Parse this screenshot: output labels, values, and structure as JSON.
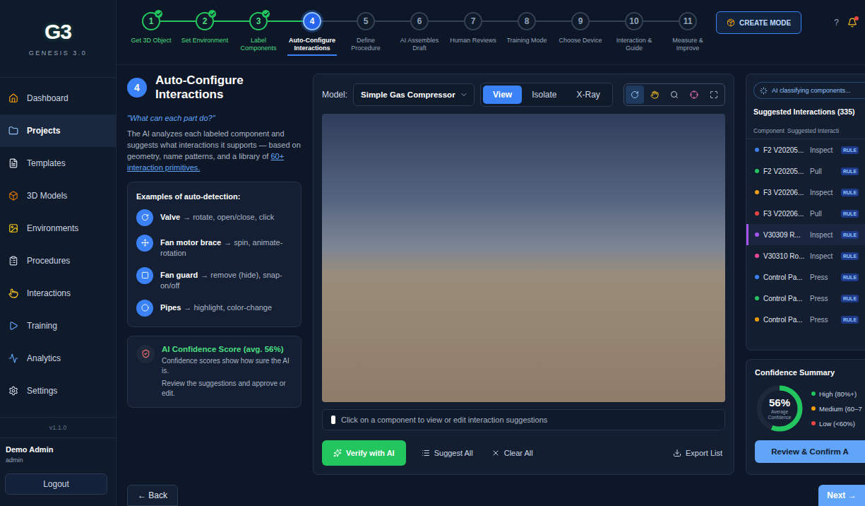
{
  "app": {
    "logo": "G3",
    "subtitle": "GENESIS 3.0",
    "version": "v1.1.0"
  },
  "sidebar": {
    "items": [
      {
        "label": "Dashboard",
        "selected": false
      },
      {
        "label": "Projects",
        "selected": true
      },
      {
        "label": "Templates",
        "selected": false
      },
      {
        "label": "3D Models",
        "selected": false
      },
      {
        "label": "Environments",
        "selected": false
      },
      {
        "label": "Procedures",
        "selected": false
      },
      {
        "label": "Interactions",
        "selected": false
      },
      {
        "label": "Training",
        "selected": false
      },
      {
        "label": "Analytics",
        "selected": false
      },
      {
        "label": "Settings",
        "selected": false
      }
    ]
  },
  "user": {
    "name": "Demo Admin",
    "role": "admin",
    "logout": "Logout"
  },
  "stepper": {
    "steps": [
      {
        "number": "1",
        "label": "Get 3D Object",
        "state": "done"
      },
      {
        "number": "2",
        "label": "Set Environment",
        "state": "done"
      },
      {
        "number": "3",
        "label": "Label Components",
        "state": "done"
      },
      {
        "number": "4",
        "label": "Auto-Configure Interactions",
        "state": "active"
      },
      {
        "number": "5",
        "label": "Define Procedure",
        "state": "pending"
      },
      {
        "number": "6",
        "label": "AI Assembles Draft",
        "state": "pending"
      },
      {
        "number": "7",
        "label": "Human Reviews",
        "state": "pending"
      },
      {
        "number": "8",
        "label": "Training Mode",
        "state": "pending"
      },
      {
        "number": "9",
        "label": "Choose Device",
        "state": "pending"
      },
      {
        "number": "10",
        "label": "Interaction & Guide",
        "state": "pending"
      },
      {
        "number": "11",
        "label": "Measure & Improve",
        "state": "pending"
      }
    ]
  },
  "header": {
    "create_mode": "CREATE MODE",
    "help": "?"
  },
  "intro": {
    "step": "4",
    "title": "Auto-Configure Interactions",
    "quote": "\"What can each part do?\"",
    "text": "The AI analyzes each labeled component and suggests what interactions it supports — based on geometry, name patterns, and a library of",
    "link": "60+ interaction primitives."
  },
  "examples": {
    "title": "Examples of auto-detection:",
    "items": [
      {
        "name": "Valve",
        "text": "→ rotate, open/close, click"
      },
      {
        "name": "Fan motor brace",
        "text": "→ spin, animate-rotation"
      },
      {
        "name": "Fan guard",
        "text": "→ remove (hide), snap-on/off"
      },
      {
        "name": "Pipes",
        "text": "→ highlight, color-change"
      }
    ]
  },
  "confidence_note": {
    "title": "AI Confidence Score (avg. 56%)",
    "lines": [
      "Confidence scores show how sure the AI is.",
      "Review the suggestions and approve or edit."
    ]
  },
  "viewer": {
    "model_label": "Model:",
    "model": "Simple Gas Compressor",
    "modes": [
      {
        "label": "View",
        "selected": true
      },
      {
        "label": "Isolate",
        "selected": false
      },
      {
        "label": "X-Ray",
        "selected": false
      }
    ],
    "tools": [
      {
        "selected": true
      },
      {
        "selected": false
      },
      {
        "selected": false
      },
      {
        "selected": false
      },
      {
        "selected": false
      }
    ],
    "hint": "Click on a component to view or edit interaction suggestions",
    "actions": [
      {
        "label": "Verify with AI",
        "kind": "primary"
      },
      {
        "label": "Suggest All",
        "kind": "ghost"
      },
      {
        "label": "Clear All",
        "kind": "ghost"
      },
      {
        "label": "Export List",
        "kind": "export"
      }
    ]
  },
  "suggestions": {
    "status": "AI classifying components...",
    "title": "Suggested Interactions (335)",
    "columns": [
      "Component",
      "Suggested Interacti"
    ],
    "rows": [
      {
        "component": "F2 V20205...",
        "interaction": "Inspect",
        "tag": "RULE",
        "color": "#3b82f6",
        "selected": false
      },
      {
        "component": "F2 V20205...",
        "interaction": "Pull",
        "tag": "RULE",
        "color": "#22c55e",
        "selected": false
      },
      {
        "component": "F3 V20206...",
        "interaction": "Inspect",
        "tag": "RULE",
        "color": "#f59e0b",
        "selected": false
      },
      {
        "component": "F3 V20206...",
        "interaction": "Pull",
        "tag": "RULE",
        "color": "#ef4444",
        "selected": false
      },
      {
        "component": "V30309 R...",
        "interaction": "Inspect",
        "tag": "RULE",
        "color": "#a855f7",
        "selected": true
      },
      {
        "component": "V30310 Ro...",
        "interaction": "Inspect",
        "tag": "RULE",
        "color": "#ec4899",
        "selected": false
      },
      {
        "component": "Control Pa...",
        "interaction": "Press",
        "tag": "RULE",
        "color": "#3b82f6",
        "selected": false
      },
      {
        "component": "Control Pa...",
        "interaction": "Press",
        "tag": "RULE",
        "color": "#22c55e",
        "selected": false
      },
      {
        "component": "Control Pa...",
        "interaction": "Press",
        "tag": "RULE",
        "color": "#f59e0b",
        "selected": false
      }
    ]
  },
  "summary": {
    "title": "Confidence Summary",
    "value": "56%",
    "caption": "Average Confidence",
    "level": 0.56,
    "legend": [
      {
        "label": "High (80%+)",
        "color": "#22c55e"
      },
      {
        "label": "Medium (60–7",
        "color": "#f59e0b"
      },
      {
        "label": "Low (<60%)",
        "color": "#ef4444"
      }
    ],
    "button": "Review & Confirm A"
  },
  "nav": {
    "back": "← Back",
    "next": "Next →"
  }
}
